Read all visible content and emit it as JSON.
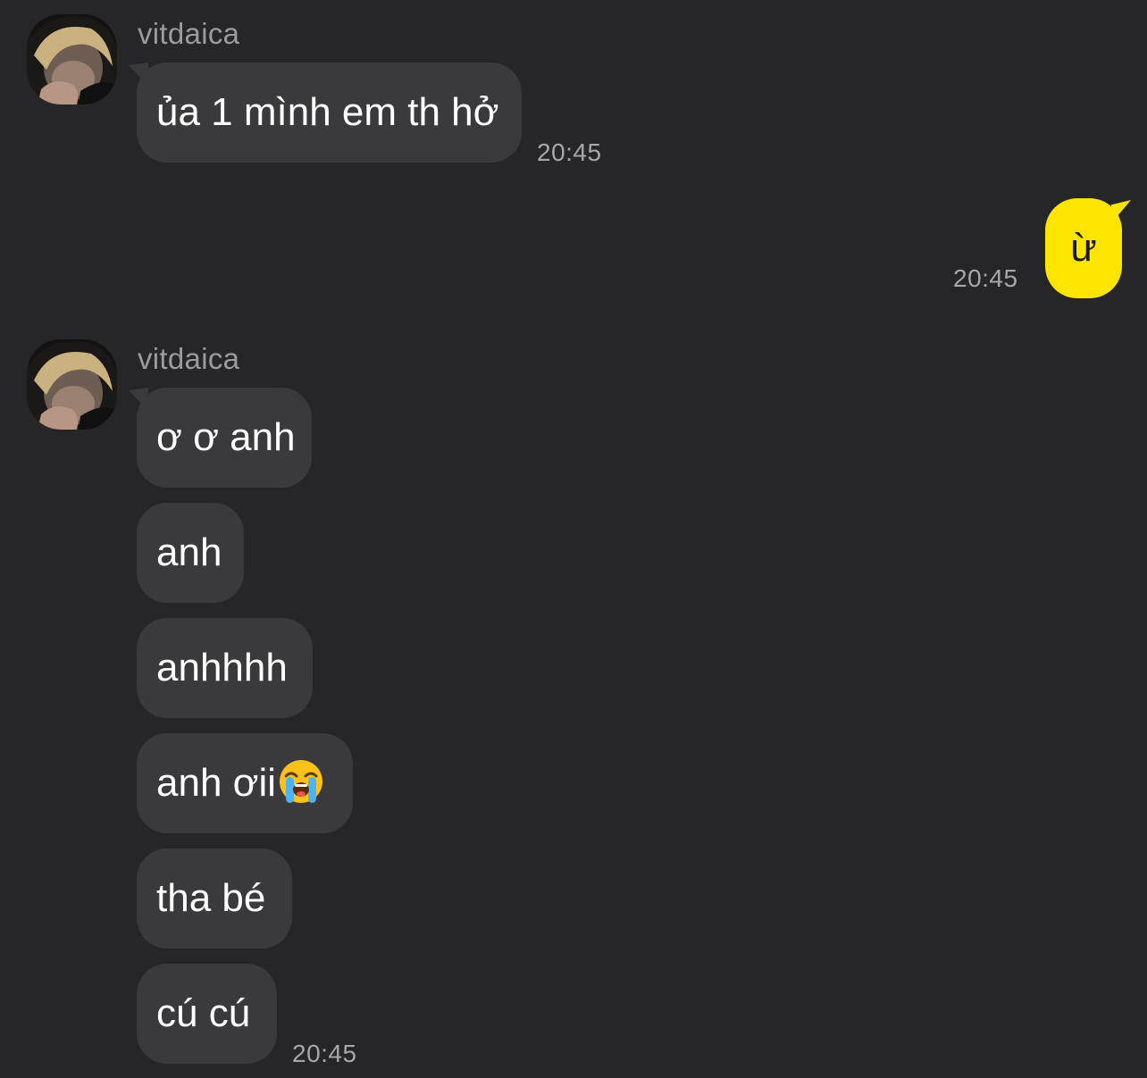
{
  "conversation": {
    "groups": [
      {
        "sender": "vitdaica",
        "messages": [
          {
            "text": "ủa 1 mình em th hở"
          }
        ],
        "time": "20:45"
      },
      {
        "sender": "me",
        "messages": [
          {
            "text": "ừ"
          }
        ],
        "time": "20:45"
      },
      {
        "sender": "vitdaica",
        "messages": [
          {
            "text": "ơ ơ anh"
          },
          {
            "text": "anh"
          },
          {
            "text": "anhhhh"
          },
          {
            "text": "anh ơii",
            "emoji": "loudly-crying-face-icon"
          },
          {
            "text": "tha bé"
          },
          {
            "text": "cú cú"
          }
        ],
        "time": "20:45"
      }
    ]
  },
  "colors": {
    "background": "#262628",
    "incoming_bubble": "#3a3a3c",
    "outgoing_bubble": "#fee500",
    "sender_name": "#9b9b9e",
    "timestamp": "#a7a7aa"
  }
}
